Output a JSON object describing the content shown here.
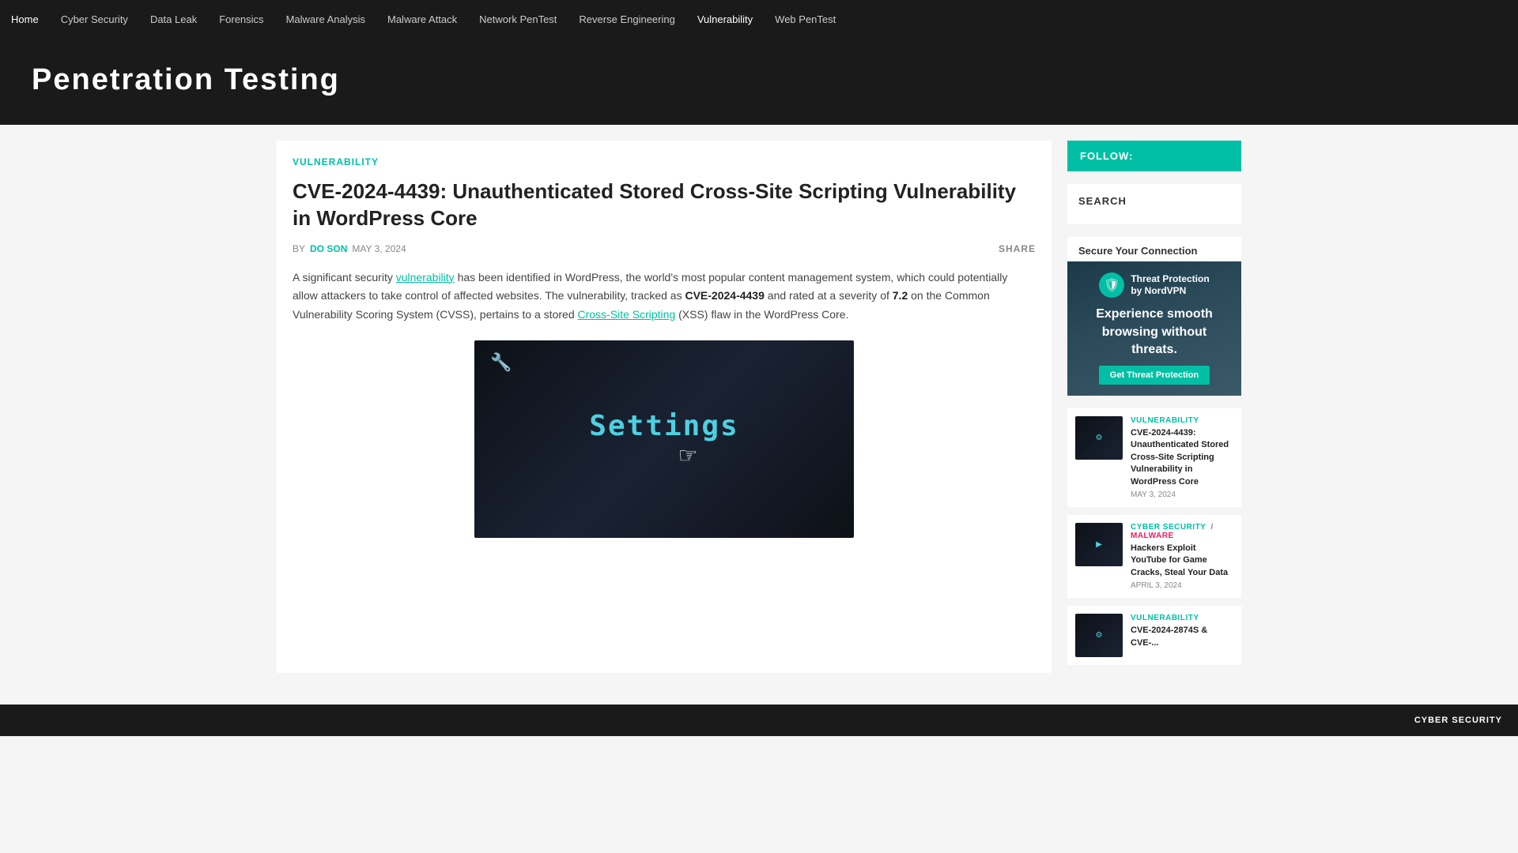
{
  "nav": {
    "items": [
      {
        "label": "Home",
        "active": false
      },
      {
        "label": "Cyber Security",
        "active": false
      },
      {
        "label": "Data Leak",
        "active": false
      },
      {
        "label": "Forensics",
        "active": false
      },
      {
        "label": "Malware Analysis",
        "active": false
      },
      {
        "label": "Malware Attack",
        "active": false
      },
      {
        "label": "Network PenTest",
        "active": false
      },
      {
        "label": "Reverse Engineering",
        "active": false
      },
      {
        "label": "Vulnerability",
        "active": true
      },
      {
        "label": "Web PenTest",
        "active": false
      }
    ]
  },
  "hero": {
    "title": "Penetration Testing"
  },
  "article": {
    "category": "VULNERABILITY",
    "title": "CVE-2024-4439: Unauthenticated Stored Cross-Site Scripting Vulnerability in WordPress Core",
    "author": "DO SON",
    "date": "MAY 3, 2024",
    "share_label": "SHARE",
    "body_intro": "A significant security",
    "vulnerability_link": "vulnerability",
    "body_mid": "has been identified in WordPress, the world's most popular content management system, which could potentially allow attackers to take control of affected websites. The vulnerability, tracked as",
    "cve_id": "CVE-2024-4439",
    "body_score": "and rated at a severity of",
    "score_value": "7.2",
    "body_cvss": "on the Common Vulnerability Scoring System (CVSS), pertains to a stored",
    "xss_link": "Cross-Site Scripting",
    "body_end": "(XSS) flaw in the WordPress Core."
  },
  "sidebar": {
    "follow_label": "FOLLOW:",
    "search_label": "SEARCH",
    "secure_title": "Secure Your Connection",
    "ad_logo_text1": "Threat Protection",
    "ad_logo_text2": "by NordVPN",
    "ad_tagline": "Experience smooth browsing without threats.",
    "ad_btn": "Get Threat Protection",
    "related": [
      {
        "category": "VULNERABILITY",
        "title": "CVE-2024-4439: Unauthenticated Stored Cross-Site Scripting Vulnerability in WordPress Core",
        "date": "MAY 3, 2024"
      },
      {
        "category1": "CYBER SECURITY",
        "slash": "/",
        "category2": "MALWARE",
        "title": "Hackers Exploit YouTube for Game Cracks, Steal Your Data",
        "date": "APRIL 3, 2024"
      },
      {
        "category": "VULNERABILITY",
        "title": "CVE-2024-2874S & CVE-...",
        "date": ""
      }
    ]
  },
  "footer": {
    "label": "CYBER SECURITY"
  }
}
